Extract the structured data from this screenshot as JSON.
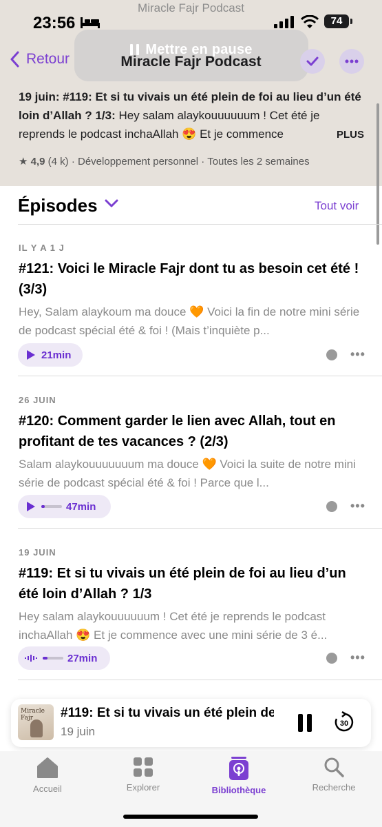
{
  "status_bar": {
    "time": "23:56",
    "battery": "74",
    "app_hint": "Miracle Fajr Podcast"
  },
  "nav": {
    "back_label": "Retour",
    "title": "Miracle Fajr Podcast",
    "pause_overlay": "Mettre en pause"
  },
  "header": {
    "description_bold": "19 juin: #119: Et si tu vivais un été plein de foi au lieu d’un été loin d’Allah ? 1/3:",
    "description_text": " Hey salam alaykouuuuuum !   Cet été je reprends le podcast inchaAllah 😍  Et je commence",
    "more_label": "PLUS",
    "rating": "4,9",
    "rating_count": "(4 k)",
    "category": "Développement personnel",
    "frequency": "Toutes les 2 semaines"
  },
  "episodes_section": {
    "title": "Épisodes",
    "see_all": "Tout voir"
  },
  "episodes": [
    {
      "date": "IL Y A 1 J",
      "title": "#121: Voici le Miracle Fajr dont tu as besoin cet été ! (3/3)",
      "desc": "Hey, Salam alaykoum ma douce 🧡   Voici la fin de notre mini série de podcast spécial été & foi !  (Mais t’inquiète p...",
      "duration": "21min",
      "progress": 0
    },
    {
      "date": "26 JUIN",
      "title": "#120: Comment garder le lien avec Allah, tout en profitant de tes vacances ? (2/3)",
      "desc": "Salam alaykouuuuuuum ma douce 🧡   Voici la suite de notre mini série de podcast spécial été & foi !   Parce que l...",
      "duration": "47min",
      "progress": 0.08
    },
    {
      "date": "19 JUIN",
      "title": "#119: Et si tu vivais un été plein de foi au lieu d’un été loin d’Allah ? 1/3",
      "desc": "Hey salam alaykouuuuuum !   Cet été je reprends le podcast inchaAllah 😍  Et je commence avec une mini série de 3 é...",
      "duration": "27min",
      "progress": 0.12
    }
  ],
  "mini_player": {
    "title": "#119: Et si tu vivais un été plein de fo",
    "date": "19 juin",
    "art_text": "Miracle Fajr"
  },
  "tabs": [
    {
      "label": "Accueil",
      "icon": "home-icon"
    },
    {
      "label": "Explorer",
      "icon": "grid-icon"
    },
    {
      "label": "Bibliothèque",
      "icon": "library-icon"
    },
    {
      "label": "Recherche",
      "icon": "search-icon"
    }
  ],
  "colors": {
    "accent": "#7b3fd1",
    "header_bg": "#e6e1db"
  }
}
